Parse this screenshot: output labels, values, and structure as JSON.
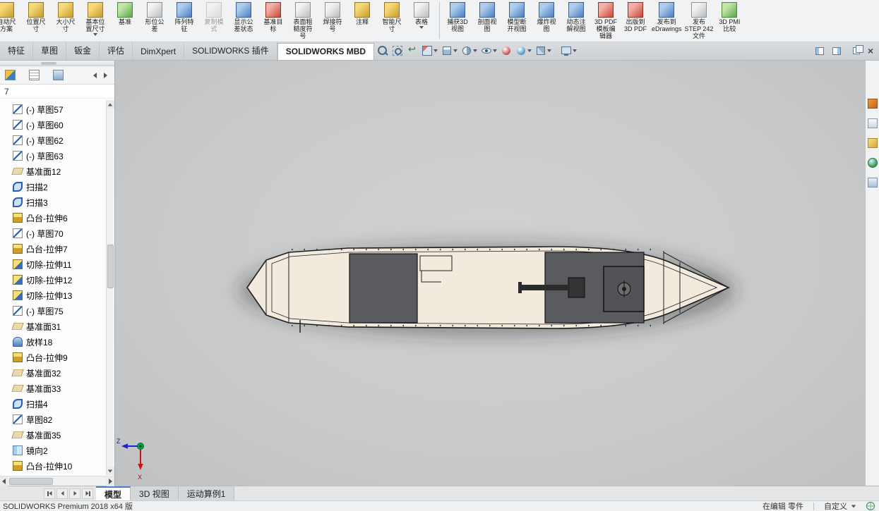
{
  "colors": {
    "hull": "#f3eade",
    "hull_outline": "#1d1d1d",
    "deck": "#595b5e",
    "deck_inner": "#515356",
    "shadow": "rgba(40,40,40,0.38)"
  },
  "ribbon": {
    "group1": [
      {
        "name": "auto-dimension-scheme-button",
        "icon": "auto-dimension-scheme-icon",
        "tint": "ri-gold",
        "label": "自动尺\n方案"
      },
      {
        "name": "location-dimension-button",
        "icon": "location-dimension-icon",
        "tint": "ri-gold",
        "label": "位置尺\n寸"
      },
      {
        "name": "size-dimension-button",
        "icon": "size-dimension-icon",
        "tint": "ri-gold",
        "label": "大小尺\n寸"
      },
      {
        "name": "basic-location-dimension-button",
        "icon": "basic-location-dimension-icon",
        "tint": "ri-gold",
        "label": "基本位\n置尺寸",
        "arrowcls": "show"
      },
      {
        "name": "datum-button",
        "icon": "datum-icon",
        "tint": "ri-green",
        "label": "基准"
      },
      {
        "name": "geometric-tolerance-button",
        "icon": "geometric-tolerance-icon",
        "tint": "ri-gray",
        "label": "形位公\n差"
      },
      {
        "name": "pattern-feature-button",
        "icon": "pattern-feature-icon",
        "tint": "ri-blue",
        "label": "阵列特\n征"
      },
      {
        "name": "copy-scheme-button",
        "icon": "copy-scheme-icon",
        "tint": "ri-gray",
        "label": "复制模\n式",
        "cls": "disabled"
      },
      {
        "name": "show-tolerance-status-button",
        "icon": "show-tolerance-status-icon",
        "tint": "ri-blue",
        "label": "显示公\n差状态"
      },
      {
        "name": "datum-target-button",
        "icon": "datum-target-icon",
        "tint": "ri-red",
        "label": "基准目\n标"
      },
      {
        "name": "surface-finish-button",
        "icon": "surface-finish-icon",
        "tint": "ri-gray",
        "label": "表面粗\n糙度符\n号"
      },
      {
        "name": "weld-symbol-button",
        "icon": "weld-symbol-icon",
        "tint": "ri-gray",
        "label": "焊接符\n号"
      },
      {
        "name": "note-button",
        "icon": "note-icon",
        "tint": "ri-gold",
        "label": "注释"
      },
      {
        "name": "smart-dimension-button",
        "icon": "smart-dimension-icon",
        "tint": "ri-gold",
        "label": "智能尺\n寸"
      },
      {
        "name": "table-button",
        "icon": "table-icon",
        "tint": "ri-gray",
        "label": "表格",
        "arrowcls": "show"
      }
    ],
    "group2": [
      {
        "name": "capture-3d-view-button",
        "icon": "capture-3d-view-icon",
        "tint": "ri-blue",
        "label": "捕获3D\n视图"
      },
      {
        "name": "section-view-ribbon-button",
        "icon": "section-view-icon",
        "tint": "ri-blue",
        "label": "剖面视\n图"
      },
      {
        "name": "model-break-view-button",
        "icon": "model-break-view-icon",
        "tint": "ri-blue",
        "label": "模型断\n开视图"
      },
      {
        "name": "exploded-view-button",
        "icon": "exploded-view-icon",
        "tint": "ri-blue",
        "label": "爆炸视\n图"
      },
      {
        "name": "dynamic-annotation-views-button",
        "icon": "dynamic-annotation-views-icon",
        "tint": "ri-blue",
        "label": "动态注\n解视图"
      },
      {
        "name": "3d-pdf-template-editor-button",
        "icon": "pdf-template-editor-icon",
        "tint": "ri-red",
        "label": "3D PDF\n模板编\n辑器"
      },
      {
        "name": "publish-3d-pdf-button",
        "icon": "publish-3d-pdf-icon",
        "tint": "ri-red",
        "label": "出版到\n3D PDF"
      },
      {
        "name": "publish-edrawings-button",
        "icon": "publish-edrawings-icon",
        "tint": "ri-blue",
        "label": "发布到\neDrawings"
      },
      {
        "name": "publish-step-242-button",
        "icon": "publish-step-242-icon",
        "tint": "ri-gray",
        "label": "发布\nSTEP 242\n文件"
      },
      {
        "name": "3d-pmi-compare-button",
        "icon": "pmi-compare-icon",
        "tint": "ri-green",
        "label": "3D PMI\n比较"
      }
    ]
  },
  "tabs": {
    "items": [
      {
        "name": "tab-features",
        "label": "特征"
      },
      {
        "name": "tab-sketch",
        "label": "草图"
      },
      {
        "name": "tab-sheet-metal",
        "label": "钣金"
      },
      {
        "name": "tab-evaluate",
        "label": "评估"
      },
      {
        "name": "tab-dimxpert",
        "label": "DimXpert"
      },
      {
        "name": "tab-solidworks-addins",
        "label": "SOLIDWORKS 插件"
      },
      {
        "name": "tab-solidworks-mbd",
        "label": "SOLIDWORKS MBD",
        "cls": "active"
      }
    ]
  },
  "headsup": {
    "buttons": [
      {
        "name": "zoom-fit-button",
        "icon": "zoom-fit-icon",
        "tint": "hi-zoomfit"
      },
      {
        "name": "zoom-area-button",
        "icon": "zoom-area-icon",
        "tint": "hi-zoomarea"
      },
      {
        "name": "previous-view-button",
        "icon": "previous-view-icon",
        "tint": "hi-prevview"
      },
      {
        "name": "section-view-button",
        "icon": "section-view-icon",
        "tint": "hi-section",
        "arrowcls": "show"
      },
      {
        "name": "view-orientation-button",
        "icon": "view-orientation-icon",
        "tint": "hi-vieworient",
        "arrowcls": "show"
      },
      {
        "name": "display-style-button",
        "icon": "display-style-icon",
        "tint": "hi-displaystyle",
        "arrowcls": "show"
      },
      {
        "name": "hide-show-items-button",
        "icon": "hide-show-items-icon",
        "tint": "hi-hideshow",
        "arrowcls": "show"
      },
      {
        "name": "edit-appearance-button",
        "icon": "edit-appearance-icon",
        "tint": "hi-appearance"
      },
      {
        "name": "apply-scene-button",
        "icon": "apply-scene-icon",
        "tint": "hi-scene",
        "arrowcls": "show"
      },
      {
        "name": "view-settings-button",
        "icon": "view-settings-icon",
        "tint": "hi-viewsettings",
        "arrowcls": "show"
      },
      {
        "name": "options-display-button",
        "icon": "monitor-icon",
        "tint": "hi-monitor",
        "arrowcls": "show"
      }
    ]
  },
  "window_controls": [
    {
      "name": "collapse-left-pane-button",
      "tint": "wc-pane-l",
      "glyph": ""
    },
    {
      "name": "collapse-right-pane-button",
      "tint": "wc-pane-r",
      "glyph": ""
    },
    {
      "name": "restore-window-button",
      "tint": "wc-restore",
      "glyph": ""
    },
    {
      "name": "close-window-button",
      "tint": "wc-close",
      "glyph": "×"
    }
  ],
  "feature_panel": {
    "partial_text": "7",
    "tabs": [
      {
        "name": "featuremanager-tab",
        "tint": "pt-fm"
      },
      {
        "name": "propertymanager-tab",
        "tint": "pt-pm"
      },
      {
        "name": "configurationmanager-tab",
        "tint": "pt-cm"
      }
    ],
    "items": [
      {
        "icon": "tic-sketch",
        "icon_name": "sketch-icon",
        "label": "(-) 草图57"
      },
      {
        "icon": "tic-sketch",
        "icon_name": "sketch-icon",
        "label": "(-) 草图60"
      },
      {
        "icon": "tic-sketch",
        "icon_name": "sketch-icon",
        "label": "(-) 草图62"
      },
      {
        "icon": "tic-sketch",
        "icon_name": "sketch-icon",
        "label": "(-) 草图63"
      },
      {
        "icon": "tic-plane",
        "icon_name": "plane-icon",
        "label": "基准面12"
      },
      {
        "icon": "tic-sweep",
        "icon_name": "sweep-icon",
        "label": "扫描2"
      },
      {
        "icon": "tic-sweep",
        "icon_name": "sweep-icon",
        "label": "扫描3"
      },
      {
        "icon": "tic-boss",
        "icon_name": "boss-extrude-icon",
        "label": "凸台-拉伸6"
      },
      {
        "icon": "tic-sketch",
        "icon_name": "sketch-icon",
        "label": "(-) 草图70"
      },
      {
        "icon": "tic-boss",
        "icon_name": "boss-extrude-icon",
        "label": "凸台-拉伸7"
      },
      {
        "icon": "tic-cut",
        "icon_name": "cut-extrude-icon",
        "label": "切除-拉伸11"
      },
      {
        "icon": "tic-cut",
        "icon_name": "cut-extrude-icon",
        "label": "切除-拉伸12"
      },
      {
        "icon": "tic-cut",
        "icon_name": "cut-extrude-icon",
        "label": "切除-拉伸13"
      },
      {
        "icon": "tic-sketch",
        "icon_name": "sketch-icon",
        "label": "(-) 草图75"
      },
      {
        "icon": "tic-plane",
        "icon_name": "plane-icon",
        "label": "基准面31"
      },
      {
        "icon": "tic-loft",
        "icon_name": "loft-icon",
        "label": "放样18"
      },
      {
        "icon": "tic-boss",
        "icon_name": "boss-extrude-icon",
        "label": "凸台-拉伸9"
      },
      {
        "icon": "tic-plane",
        "icon_name": "plane-icon",
        "label": "基准面32"
      },
      {
        "icon": "tic-plane",
        "icon_name": "plane-icon",
        "label": "基准面33"
      },
      {
        "icon": "tic-sweep",
        "icon_name": "sweep-icon",
        "label": "扫描4"
      },
      {
        "icon": "tic-sketch",
        "icon_name": "sketch-icon",
        "label": "草图82"
      },
      {
        "icon": "tic-plane",
        "icon_name": "plane-icon",
        "label": "基准面35"
      },
      {
        "icon": "tic-mirror",
        "icon_name": "mirror-icon",
        "label": "镜向2"
      },
      {
        "icon": "tic-boss",
        "icon_name": "boss-extrude-icon",
        "label": "凸台-拉伸10"
      }
    ]
  },
  "taskpane": {
    "icons": [
      {
        "name": "solidworks-resources-icon",
        "tint": "rs-home"
      },
      {
        "name": "design-library-icon",
        "tint": "rs-lib"
      },
      {
        "name": "file-explorer-icon",
        "tint": "rs-explorer"
      },
      {
        "name": "appearances-icon",
        "tint": "rs-appearance"
      },
      {
        "name": "custom-properties-icon",
        "tint": "rs-props"
      }
    ]
  },
  "viewport": {
    "triad": {
      "z": "Z",
      "x": "X"
    }
  },
  "bottom_tabs": {
    "items": [
      {
        "name": "tab-model",
        "label": "模型",
        "cls": "active"
      },
      {
        "name": "tab-3d-views",
        "label": "3D 视图"
      },
      {
        "name": "tab-motion-study-1",
        "label": "运动算例1"
      }
    ]
  },
  "statusbar": {
    "app_version": "SOLIDWORKS Premium 2018 x64 版",
    "editing_status": "在编辑 零件",
    "custom_label": "自定义"
  }
}
